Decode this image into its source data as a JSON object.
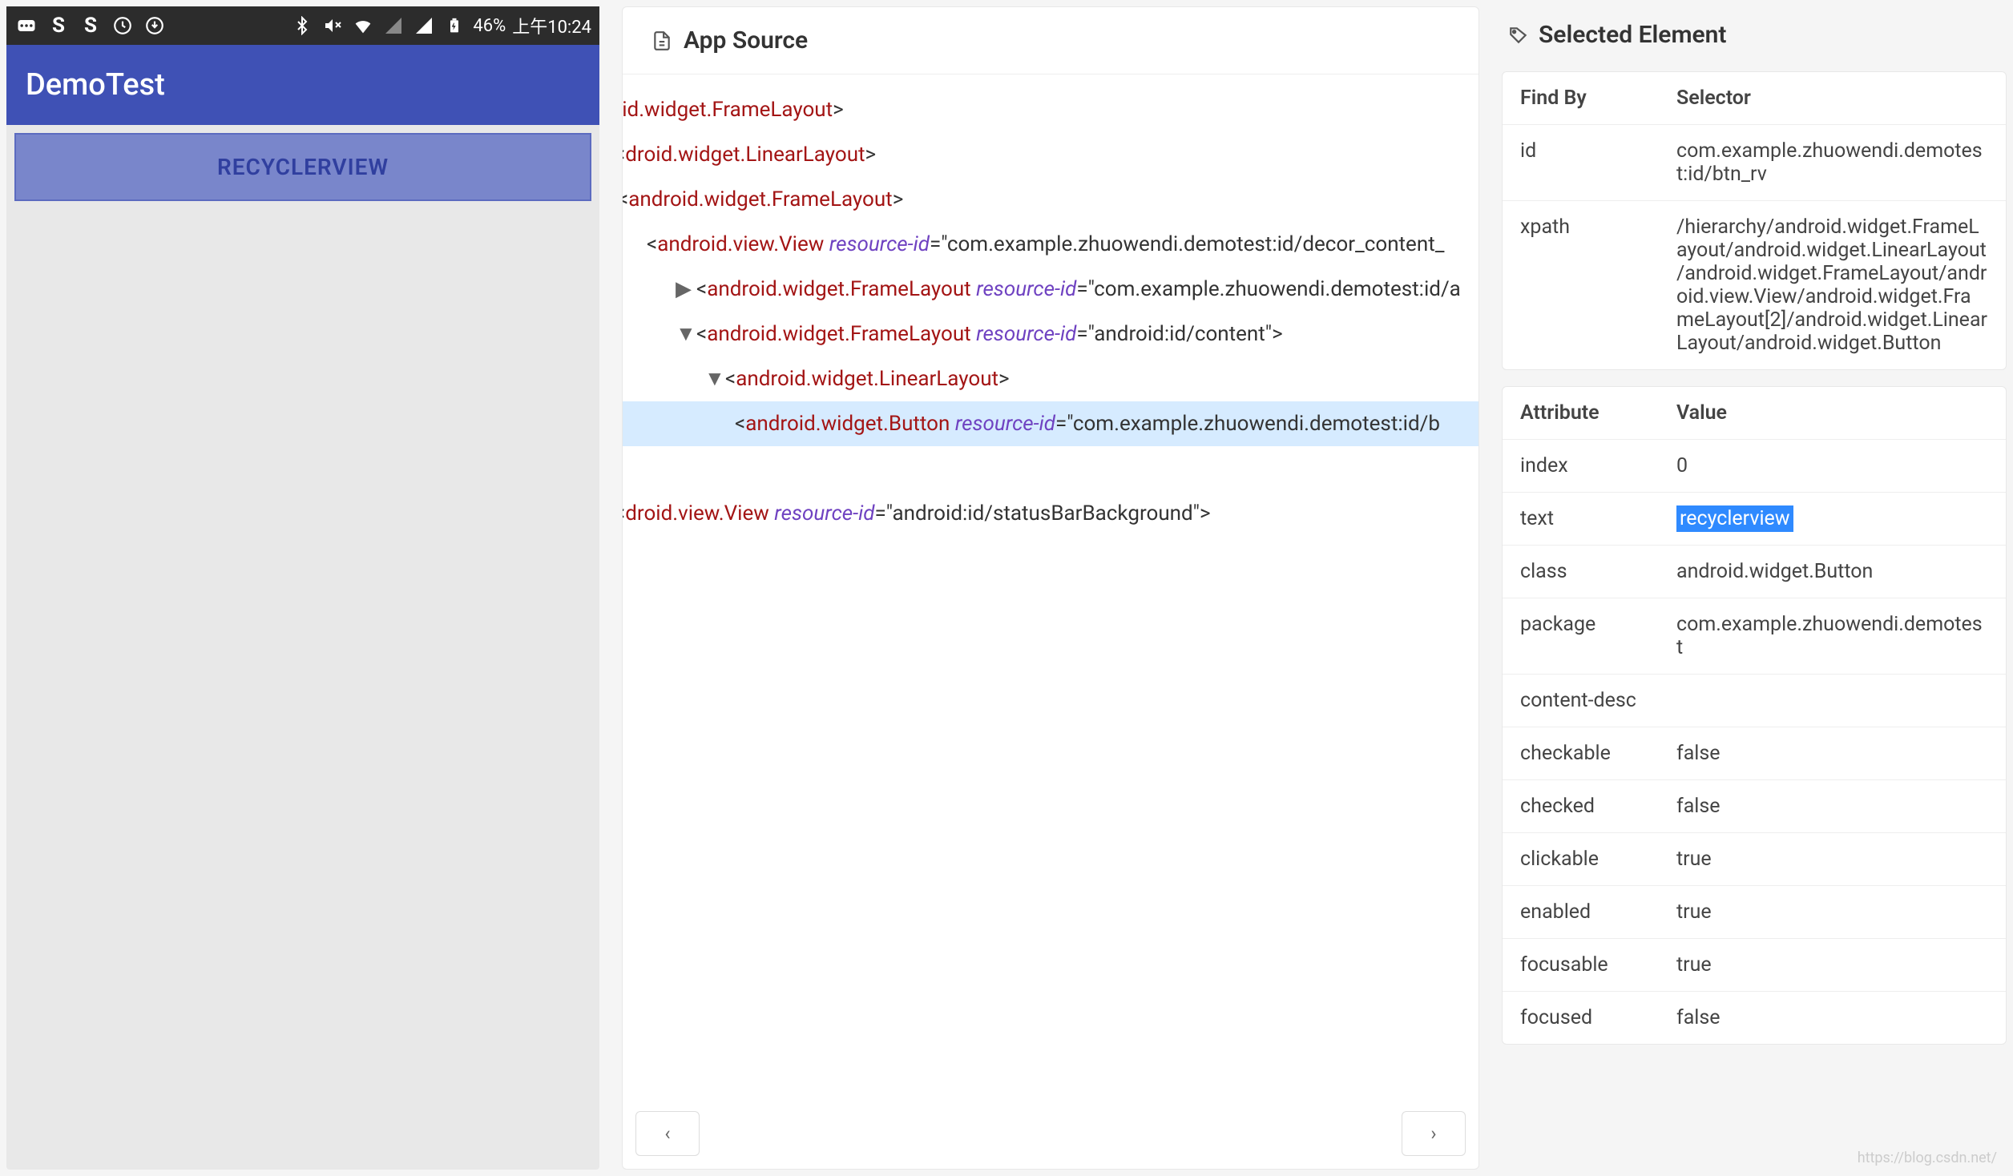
{
  "phone": {
    "status": {
      "battery_pct": "46%",
      "time": "上午10:24"
    },
    "app_title": "DemoTest",
    "button_label": "RECYCLERVIEW"
  },
  "source": {
    "title": "App Source",
    "tree": [
      {
        "indent": -14,
        "arrow": "",
        "tag": "id.widget.FrameLayout",
        "attr": "",
        "val": "",
        "selected": false
      },
      {
        "indent": -10,
        "arrow": "",
        "tag": "droid.widget.LinearLayout",
        "attr": "",
        "val": "",
        "selected": false
      },
      {
        "indent": -6,
        "arrow": "",
        "tag": "android.widget.FrameLayout",
        "attr": "",
        "val": "",
        "selected": false
      },
      {
        "indent": 30,
        "arrow": "",
        "tag": "android.view.View",
        "attr": "resource-id",
        "val": "\"com.example.zhuowendi.demotest:id/decor_content_",
        "selected": false
      },
      {
        "indent": 66,
        "arrow": "▶",
        "tag": "android.widget.FrameLayout",
        "attr": "resource-id",
        "val": "\"com.example.zhuowendi.demotest:id/a",
        "selected": false
      },
      {
        "indent": 66,
        "arrow": "▼",
        "tag": "android.widget.FrameLayout",
        "attr": "resource-id",
        "val": "\"android:id/content\">",
        "selected": false
      },
      {
        "indent": 102,
        "arrow": "▼",
        "tag": "android.widget.LinearLayout",
        "attr": "",
        "val": "",
        "selected": false
      },
      {
        "indent": 140,
        "arrow": "",
        "tag": "android.widget.Button",
        "attr": "resource-id",
        "val": "\"com.example.zhuowendi.demotest:id/b",
        "selected": true
      },
      {
        "indent": -14,
        "arrow": "",
        "spacer": true
      },
      {
        "indent": -10,
        "arrow": "",
        "tag": "droid.view.View",
        "attr": "resource-id",
        "val": "\"android:id/statusBarBackground\">",
        "selected": false
      }
    ],
    "nav_prev": "‹",
    "nav_next": "›"
  },
  "selected": {
    "title": "Selected Element",
    "findby": {
      "header_key": "Find By",
      "header_val": "Selector",
      "rows": [
        {
          "k": "id",
          "v": "com.example.zhuowendi.demotest:id/btn_rv"
        },
        {
          "k": "xpath",
          "v": "/hierarchy/android.widget.FrameLayout/android.widget.LinearLayout/android.widget.FrameLayout/android.view.View/android.widget.FrameLayout[2]/android.widget.LinearLayout/android.widget.Button"
        }
      ]
    },
    "attrs": {
      "header_key": "Attribute",
      "header_val": "Value",
      "rows": [
        {
          "k": "index",
          "v": "0",
          "hl": false
        },
        {
          "k": "text",
          "v": "recyclerview",
          "hl": true
        },
        {
          "k": "class",
          "v": "android.widget.Button",
          "hl": false
        },
        {
          "k": "package",
          "v": "com.example.zhuowendi.demotest",
          "hl": false
        },
        {
          "k": "content-desc",
          "v": "",
          "hl": false
        },
        {
          "k": "checkable",
          "v": "false",
          "hl": false
        },
        {
          "k": "checked",
          "v": "false",
          "hl": false
        },
        {
          "k": "clickable",
          "v": "true",
          "hl": false
        },
        {
          "k": "enabled",
          "v": "true",
          "hl": false
        },
        {
          "k": "focusable",
          "v": "true",
          "hl": false
        },
        {
          "k": "focused",
          "v": "false",
          "hl": false
        }
      ]
    }
  },
  "watermark": "https://blog.csdn.net/"
}
